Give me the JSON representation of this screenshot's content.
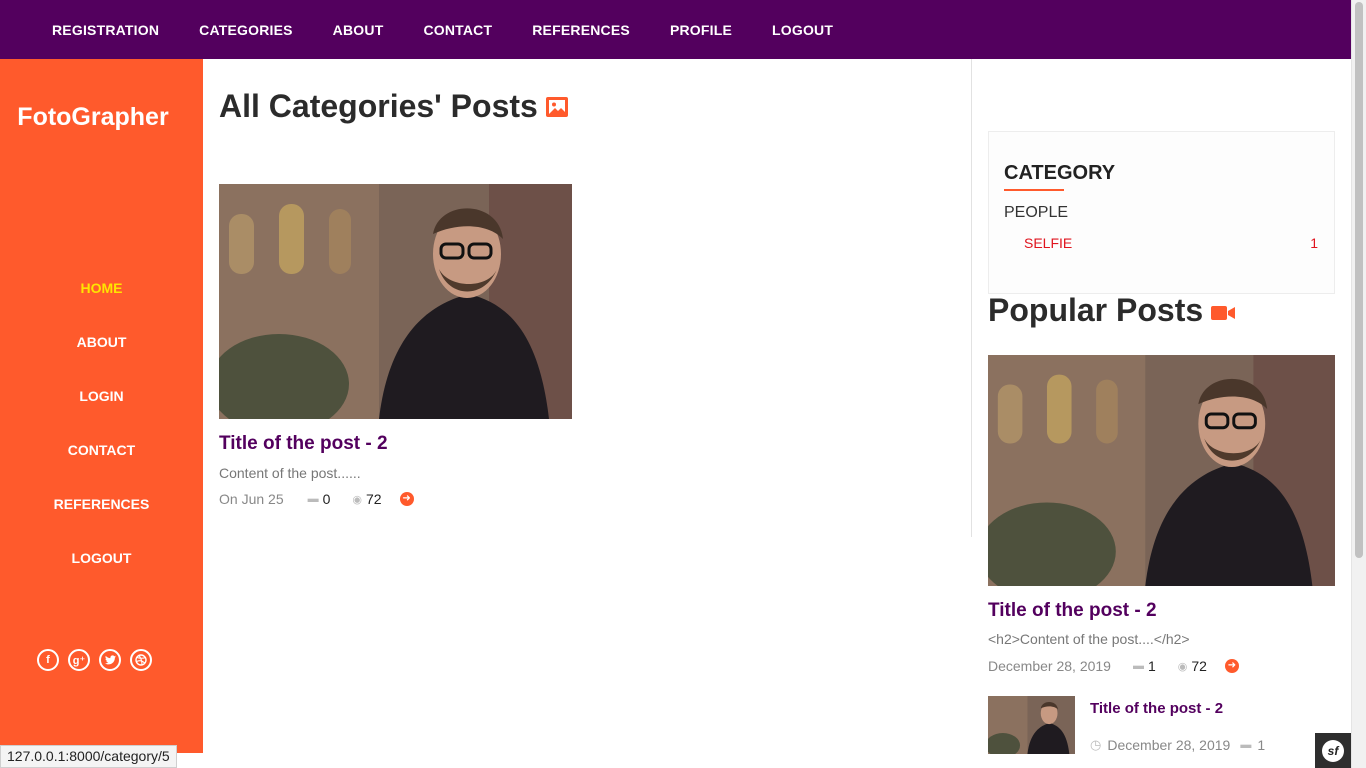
{
  "topnav": {
    "items": [
      {
        "label": "REGISTRATION"
      },
      {
        "label": "CATEGORIES"
      },
      {
        "label": "ABOUT"
      },
      {
        "label": "CONTACT"
      },
      {
        "label": "REFERENCES"
      },
      {
        "label": "PROFILE"
      },
      {
        "label": "LOGOUT"
      }
    ],
    "background": "#53005e"
  },
  "sidebar": {
    "brand": "FotoGrapher",
    "background": "#ff5a2c",
    "items": [
      {
        "label": "HOME",
        "active": true
      },
      {
        "label": "ABOUT"
      },
      {
        "label": "LOGIN"
      },
      {
        "label": "CONTACT"
      },
      {
        "label": "REFERENCES"
      },
      {
        "label": "LOGOUT"
      }
    ],
    "socials": [
      "facebook-icon",
      "google-plus-icon",
      "twitter-icon",
      "dribbble-icon"
    ]
  },
  "main": {
    "title": "All Categories' Posts",
    "title_icon": "image-icon",
    "post": {
      "title": "Title of the post - 2",
      "excerpt": "Content of the post......",
      "date": "On Jun 25",
      "comments": "0",
      "views": "72"
    }
  },
  "category_widget": {
    "heading": "CATEGORY",
    "parent": "PEOPLE",
    "child": "SELFIE",
    "child_count": "1"
  },
  "popular": {
    "title": "Popular Posts",
    "title_icon": "video-camera-icon",
    "featured": {
      "title": "Title of the post - 2",
      "excerpt": "<h2>Content of the post....</h2>",
      "date": "December 28, 2019",
      "comments": "1",
      "views": "72"
    },
    "item": {
      "title": "Title of the post - 2",
      "date": "December 28, 2019",
      "comments": "1"
    }
  },
  "status_bar": {
    "url": "127.0.0.1:8000/category/5"
  },
  "colors": {
    "accent": "#ff5a2c",
    "purple": "#53005e",
    "category_red": "#e0141e",
    "active_yellow": "#ffe400"
  }
}
